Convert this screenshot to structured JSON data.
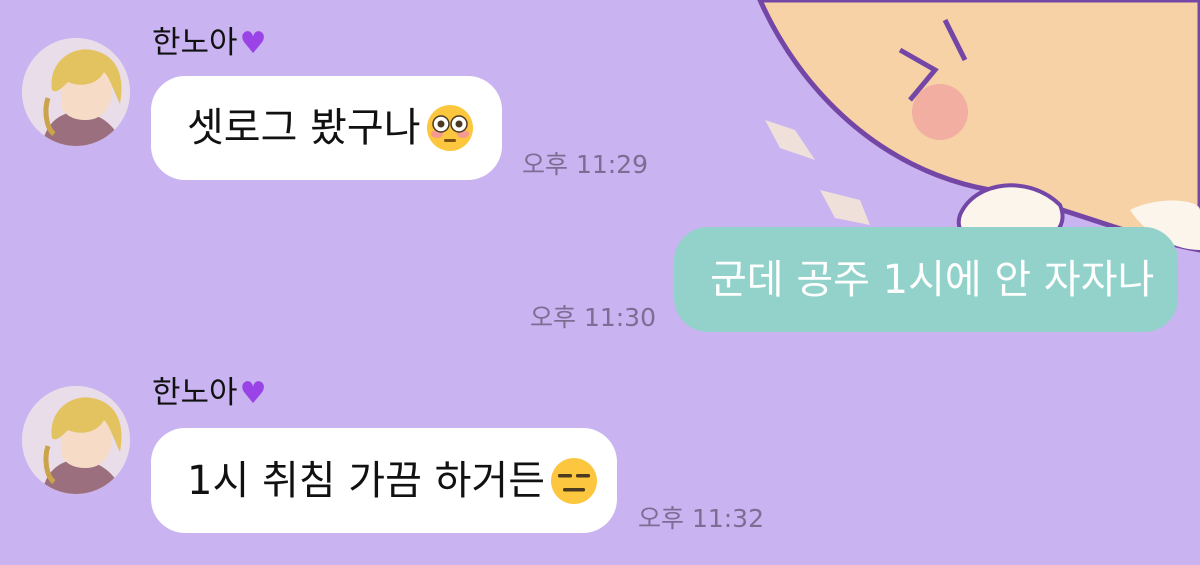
{
  "theme": {
    "background": "#c9b3f1",
    "incoming_bubble": "#ffffff",
    "outgoing_bubble": "#92d2cb",
    "heart_color": "#9a43e6"
  },
  "messages": [
    {
      "direction": "incoming",
      "sender": "한노아",
      "sender_badge_icon": "purple-heart",
      "text": "셋로그 봤구나",
      "emoji_icon": "flushed-face",
      "time": "오후 11:29"
    },
    {
      "direction": "outgoing",
      "text": "군데 공주 1시에 안 자자나",
      "time": "오후 11:30"
    },
    {
      "direction": "incoming",
      "sender": "한노아",
      "sender_badge_icon": "purple-heart",
      "text": "1시 취침 가끔 하거든",
      "emoji_icon": "expressionless-face",
      "time": "오후 11:32"
    }
  ]
}
